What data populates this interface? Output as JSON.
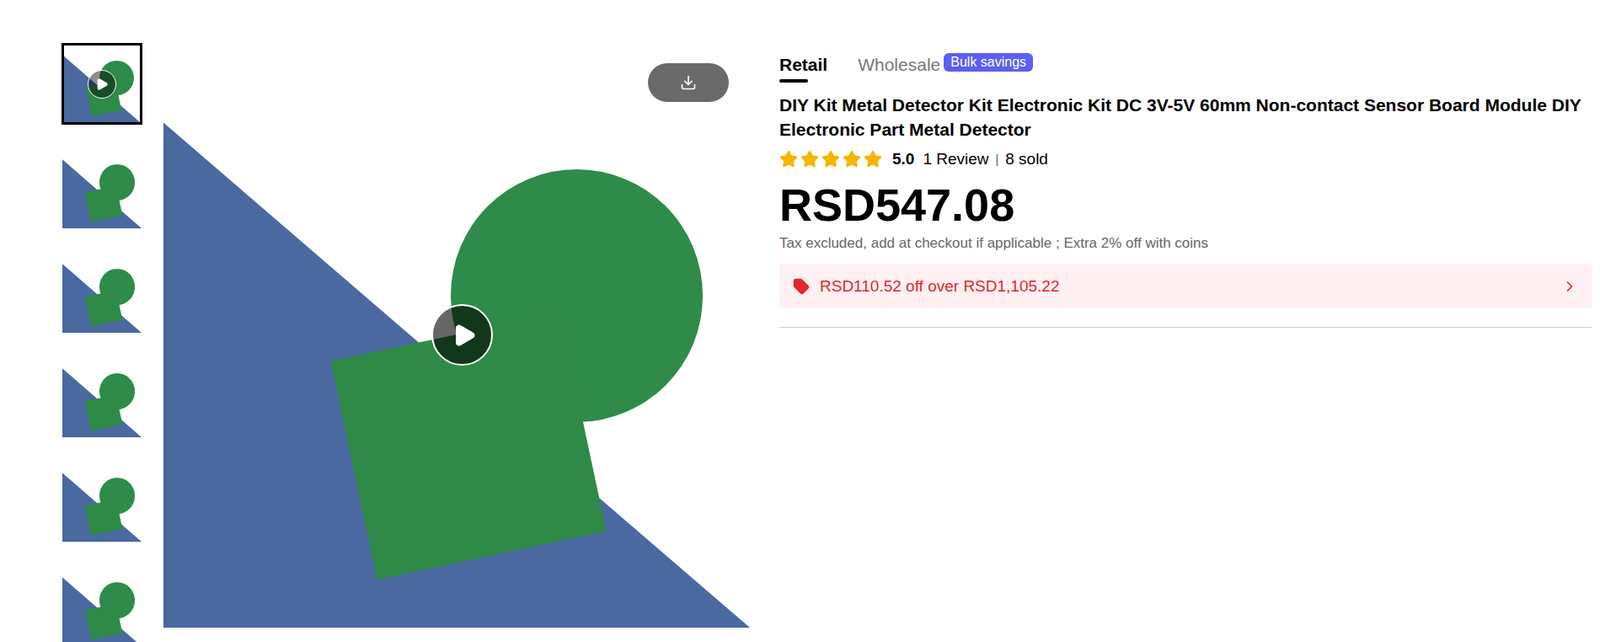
{
  "gallery": {
    "thumbnails": [
      {
        "selected": true,
        "has_video": true
      },
      {
        "selected": false,
        "has_video": false
      },
      {
        "selected": false,
        "has_video": false
      },
      {
        "selected": false,
        "has_video": false
      },
      {
        "selected": false,
        "has_video": false
      },
      {
        "selected": false,
        "has_video": false
      }
    ],
    "main_has_video": true
  },
  "tabs": [
    {
      "label": "Retail",
      "selected": true
    },
    {
      "label": "Wholesale",
      "selected": false,
      "badge": "Bulk savings"
    }
  ],
  "product": {
    "title": "DIY Kit Metal Detector Kit Electronic Kit DC 3V-5V 60mm Non-contact Sensor Board Module DIY Electronic Part Metal Detector",
    "rating": {
      "stars": 5,
      "score": "5.0",
      "reviews": "1 Review",
      "separator": "|",
      "sold": "8 sold"
    },
    "price": "RSD547.08",
    "tax_note": "Tax excluded, add at checkout if applicable ; Extra 2% off with coins",
    "coupon": "RSD110.52 off over RSD1,105.22"
  }
}
